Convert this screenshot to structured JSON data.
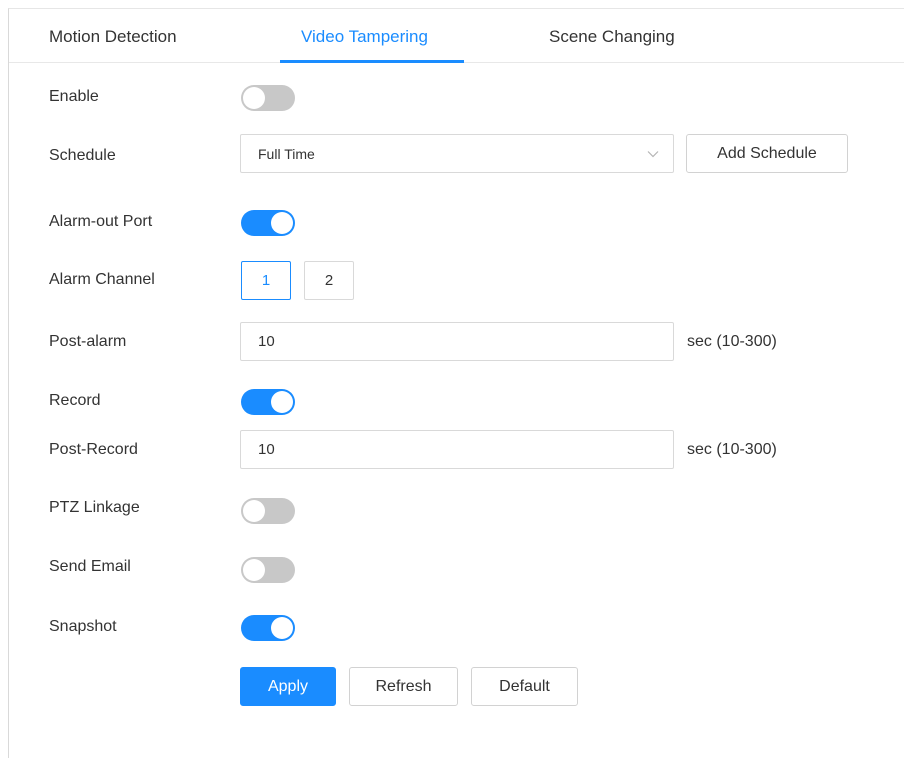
{
  "tabs": [
    {
      "label": "Motion Detection",
      "active": false
    },
    {
      "label": "Video Tampering",
      "active": true
    },
    {
      "label": "Scene Changing",
      "active": false
    }
  ],
  "colors": {
    "accent": "#1a8cff",
    "toggle_off": "#c8c8c8",
    "border": "#d9d9d9"
  },
  "enable": {
    "label": "Enable",
    "on": false
  },
  "schedule": {
    "label": "Schedule",
    "value": "Full Time",
    "add_label": "Add Schedule"
  },
  "alarm_out_port": {
    "label": "Alarm-out Port",
    "on": true
  },
  "alarm_channel": {
    "label": "Alarm Channel",
    "options": [
      "1",
      "2"
    ],
    "selected": "1"
  },
  "post_alarm": {
    "label": "Post-alarm",
    "value": "10",
    "unit": "sec (10-300)"
  },
  "record": {
    "label": "Record",
    "on": true
  },
  "post_record": {
    "label": "Post-Record",
    "value": "10",
    "unit": "sec (10-300)"
  },
  "ptz_linkage": {
    "label": "PTZ Linkage",
    "on": false
  },
  "send_email": {
    "label": "Send Email",
    "on": false
  },
  "snapshot": {
    "label": "Snapshot",
    "on": true
  },
  "actions": {
    "apply": "Apply",
    "refresh": "Refresh",
    "default": "Default"
  },
  "icons": {
    "schedule_dropdown": "chevron-down-icon"
  }
}
